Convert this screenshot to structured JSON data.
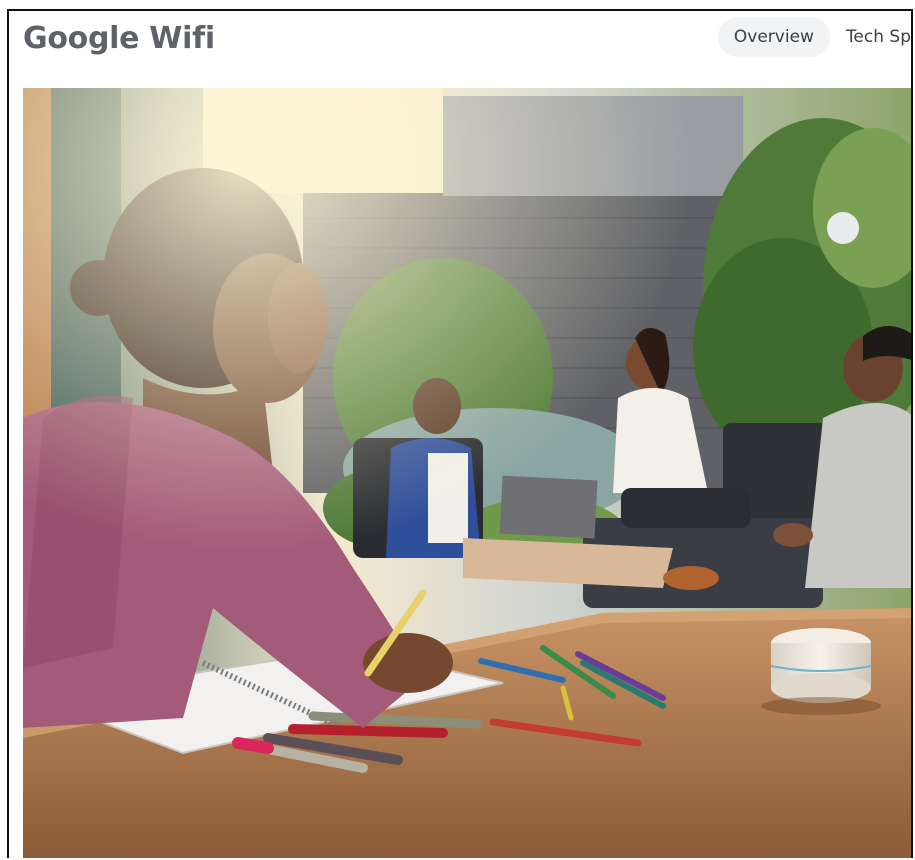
{
  "header": {
    "brand": "Google Wifi",
    "tabs": [
      {
        "label": "Overview",
        "active": true
      },
      {
        "label": "Tech Sp",
        "active": false
      }
    ]
  },
  "hero": {
    "icon": "lifestyle-photo",
    "colors": {
      "table": "#b07a4f",
      "wall": "#5f6166",
      "router": "#ebe4db"
    }
  }
}
